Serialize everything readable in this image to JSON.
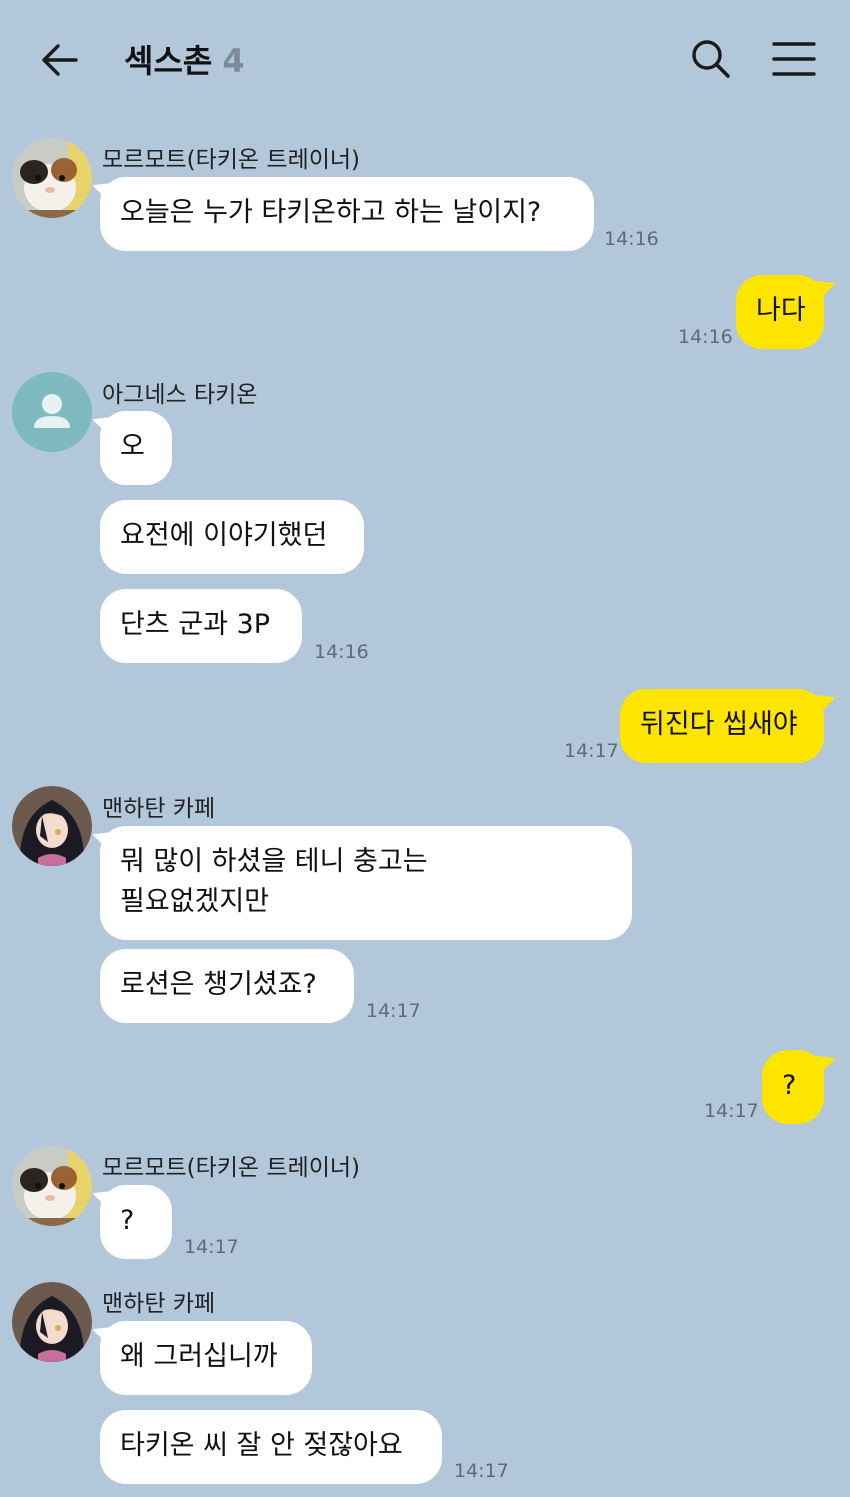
{
  "header": {
    "title": "섹스촌",
    "member_count": "4"
  },
  "icons": {
    "back": "arrow-left-icon",
    "search": "search-icon",
    "menu": "hamburger-menu-icon"
  },
  "colors": {
    "background": "#b2c7da",
    "incoming_bubble": "#ffffff",
    "outgoing_bubble": "#fee500",
    "timestamp": "#5c6b79"
  },
  "messages": [
    {
      "sender": "모르모트(타키온 트레이너)",
      "text": "오늘은 누가 타키온하고 하는 날이지?",
      "time": "14:16"
    },
    {
      "text": "나다",
      "time": "14:16"
    },
    {
      "sender": "아그네스 타키온",
      "text": "오"
    },
    {
      "text": "요전에 이야기했던"
    },
    {
      "text": "단츠 군과 3P",
      "time": "14:16"
    },
    {
      "text": "뒤진다 씹새야",
      "time": "14:17"
    },
    {
      "sender": "맨하탄 카페",
      "line1": "뭐 많이 하셨을 테니 충고는",
      "line2": "필요없겠지만"
    },
    {
      "text": "로션은 챙기셨죠?",
      "time": "14:17"
    },
    {
      "text": "?",
      "time": "14:17"
    },
    {
      "sender": "모르모트(타키온 트레이너)",
      "text": "?",
      "time": "14:17"
    },
    {
      "sender": "맨하탄 카페",
      "text": "왜 그러십니까"
    },
    {
      "text": "타키온 씨 잘 안 젖잖아요",
      "time": "14:17"
    }
  ]
}
